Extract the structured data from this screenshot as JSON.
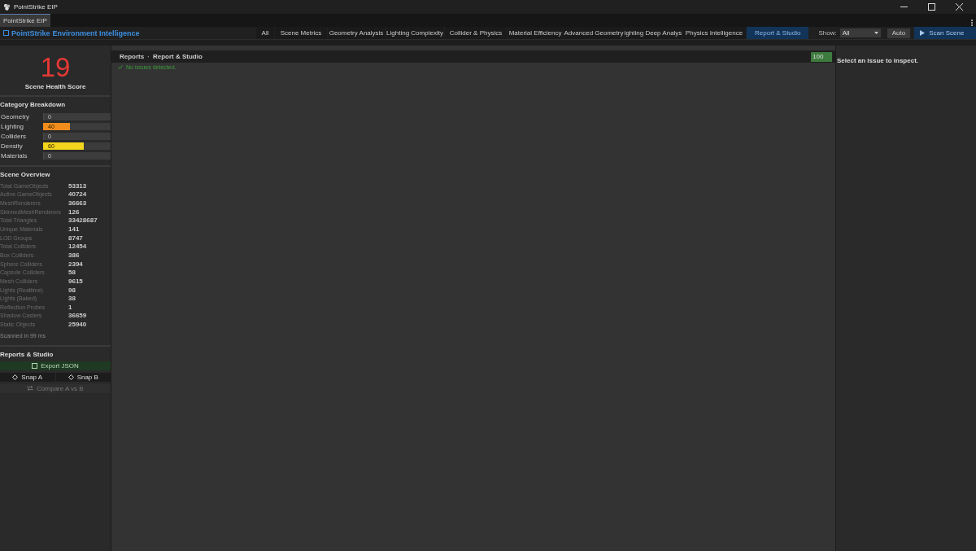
{
  "window": {
    "title": "PointStrike EIP"
  },
  "doc_tab": {
    "label": "PointStrike EIP",
    "selected": true
  },
  "brand": {
    "name": "PointStrike",
    "subtitle": "Environment Intelligence"
  },
  "tabs": [
    {
      "label": "All",
      "selected": false
    },
    {
      "label": "Scene Metrics",
      "selected": false
    },
    {
      "label": "Geometry Analysis",
      "selected": false
    },
    {
      "label": "Lighting Complexity",
      "selected": false
    },
    {
      "label": "Collider & Physics",
      "selected": false
    },
    {
      "label": "Material Efficiency",
      "selected": false
    },
    {
      "label": "Advanced Geometry",
      "selected": false
    },
    {
      "label": "ighting Deep Analys",
      "selected": false
    },
    {
      "label": "Physics Intelligence",
      "selected": false
    },
    {
      "label": "Report & Studio",
      "selected": true
    }
  ],
  "show_filter": {
    "label": "Show:",
    "value": "All"
  },
  "auto_button": "Auto",
  "scan_button": "Scan Scene",
  "health": {
    "score": "19",
    "label": "Scene Health Score"
  },
  "category_breakdown": {
    "title": "Category Breakdown",
    "items": [
      {
        "name": "Geometry",
        "value": "0",
        "level": 0
      },
      {
        "name": "Lighting",
        "value": "40",
        "level": 0.4,
        "color": "#f28c1c"
      },
      {
        "name": "Colliders",
        "value": "0",
        "level": 0
      },
      {
        "name": "Density",
        "value": "60",
        "level": 0.6,
        "color": "#f2d51c"
      },
      {
        "name": "Materials",
        "value": "0",
        "level": 0
      }
    ]
  },
  "scene_overview": {
    "title": "Scene Overview",
    "rows": [
      {
        "label": "Total GameObjects",
        "value": "53313"
      },
      {
        "label": "Active GameObjects",
        "value": "40724"
      },
      {
        "label": "MeshRenderers",
        "value": "36663"
      },
      {
        "label": "SkinnedMeshRenderers",
        "value": "126"
      },
      {
        "label": "Total Triangles",
        "value": "33428687"
      },
      {
        "label": "Unique Materials",
        "value": "141"
      },
      {
        "label": "LOD Groups",
        "value": "8747"
      },
      {
        "label": "Total Colliders",
        "value": "12454"
      },
      {
        "label": "Box Colliders",
        "value": "386"
      },
      {
        "label": "Sphere Colliders",
        "value": "2394"
      },
      {
        "label": "Capsule Colliders",
        "value": "58"
      },
      {
        "label": "Mesh Colliders",
        "value": "9615"
      },
      {
        "label": "Lights (Realtime)",
        "value": "98"
      },
      {
        "label": "Lights (Baked)",
        "value": "38"
      },
      {
        "label": "Reflection Probes",
        "value": "1"
      },
      {
        "label": "Shadow Casters",
        "value": "36659"
      },
      {
        "label": "Static Objects",
        "value": "25940"
      }
    ],
    "footer": "Scanned in 99 ms"
  },
  "reports_studio": {
    "title": "Reports & Studio",
    "export_button": "Export JSON",
    "snap_buttons": [
      "Snap A",
      "Snap B"
    ],
    "compare_button": {
      "label": "Compare A vs B",
      "disabled": true
    }
  },
  "report_panel": {
    "breadcrumb": [
      "Reports",
      "Report & Studio"
    ],
    "breadcrumb_separator": "·",
    "badge": "100",
    "message": "No issues detected."
  },
  "inspector": {
    "hint": "Select an issue to inspect."
  }
}
